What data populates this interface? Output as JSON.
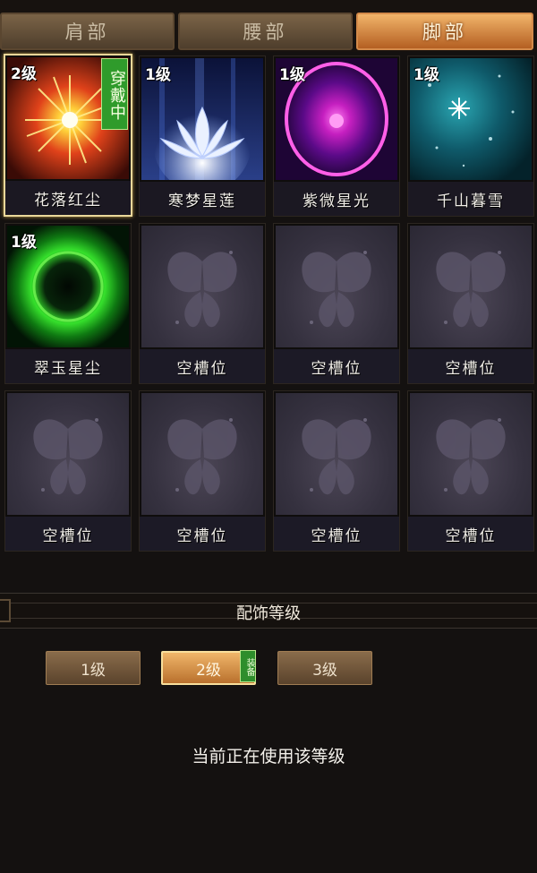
{
  "tabs": [
    {
      "label": "肩部",
      "active": false
    },
    {
      "label": "腰部",
      "active": false
    },
    {
      "label": "脚部",
      "active": true
    }
  ],
  "slots": [
    {
      "name": "花落红尘",
      "level": "2级",
      "wearing": "穿戴中",
      "icon": "red-starburst-icon"
    },
    {
      "name": "寒梦星莲",
      "level": "1级",
      "icon": "white-lotus-icon"
    },
    {
      "name": "紫微星光",
      "level": "1级",
      "icon": "purple-orb-icon"
    },
    {
      "name": "千山暮雪",
      "level": "1级",
      "icon": "snowflake-icon"
    },
    {
      "name": "翠玉星尘",
      "level": "1级",
      "icon": "green-ring-icon"
    },
    {
      "name": "空槽位",
      "icon": "butterfly-icon"
    },
    {
      "name": "空槽位",
      "icon": "butterfly-icon"
    },
    {
      "name": "空槽位",
      "icon": "butterfly-icon"
    },
    {
      "name": "空槽位",
      "icon": "butterfly-icon"
    },
    {
      "name": "空槽位",
      "icon": "butterfly-icon"
    },
    {
      "name": "空槽位",
      "icon": "butterfly-icon"
    },
    {
      "name": "空槽位",
      "icon": "butterfly-icon"
    }
  ],
  "section_title": "配饰等级",
  "levels": [
    {
      "label": "1级",
      "active": false
    },
    {
      "label": "2级",
      "active": true
    },
    {
      "label": "3级",
      "active": false
    }
  ],
  "equip_badge": "装备",
  "status_text": "当前正在使用该等级",
  "colors": {
    "tab_active": "#e59a4e",
    "wearing_badge": "#2f9b2b",
    "selected_border": "#e9d79a",
    "empty_slot": "#35313f"
  }
}
